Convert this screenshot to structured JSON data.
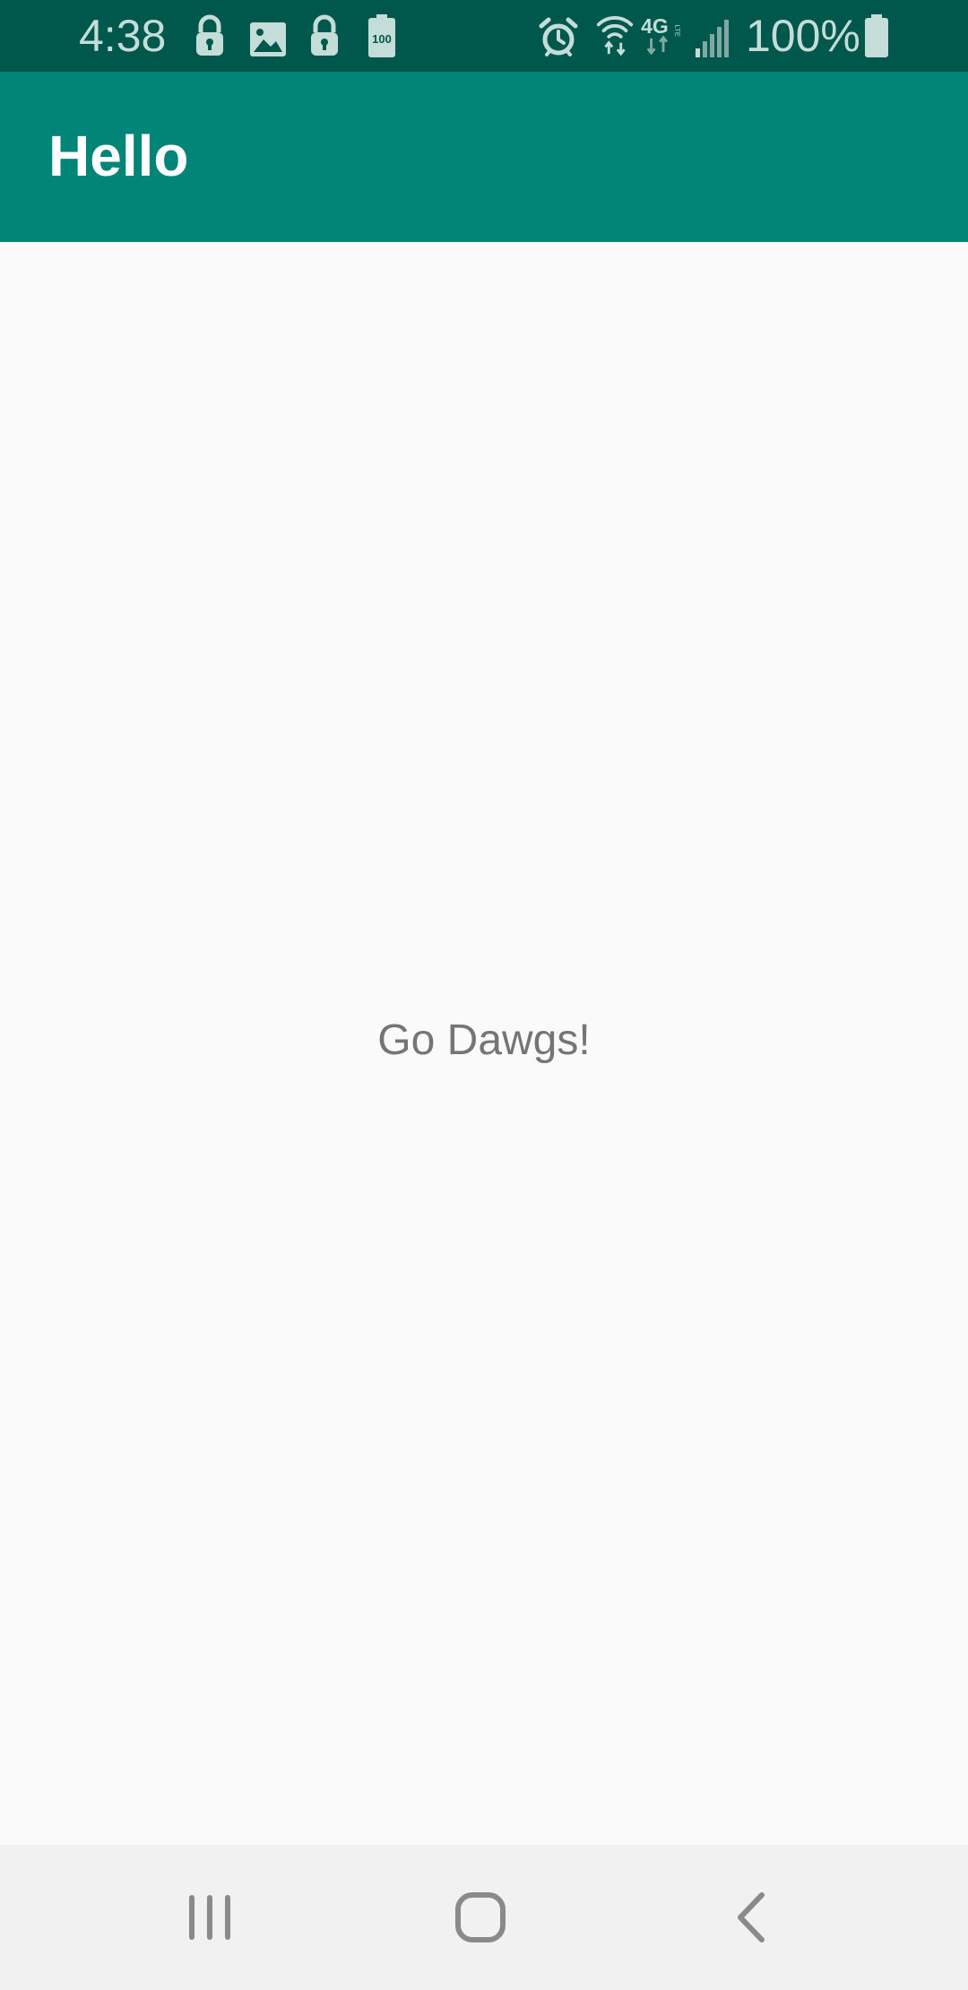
{
  "status_bar": {
    "time": "4:38",
    "battery_percent": "100%",
    "left_icons": [
      "lock-icon",
      "image-icon",
      "lock-icon",
      "battery-100-icon"
    ],
    "right_icons": [
      "alarm-icon",
      "wifi-icon",
      "network-4g-lte-icon",
      "signal-icon",
      "battery-icon"
    ],
    "battery_badge": "100",
    "network_label": "4G",
    "network_sub": "LTE"
  },
  "app_bar": {
    "title": "Hello"
  },
  "main": {
    "message": "Go Dawgs!"
  },
  "nav_bar": {
    "buttons": [
      "recent-apps-icon",
      "home-icon",
      "back-icon"
    ]
  },
  "colors": {
    "status_bar": "#00574b",
    "app_bar": "#008577",
    "background": "#fafafa",
    "text_secondary": "#757575",
    "nav_bar": "#f1f1f1"
  }
}
